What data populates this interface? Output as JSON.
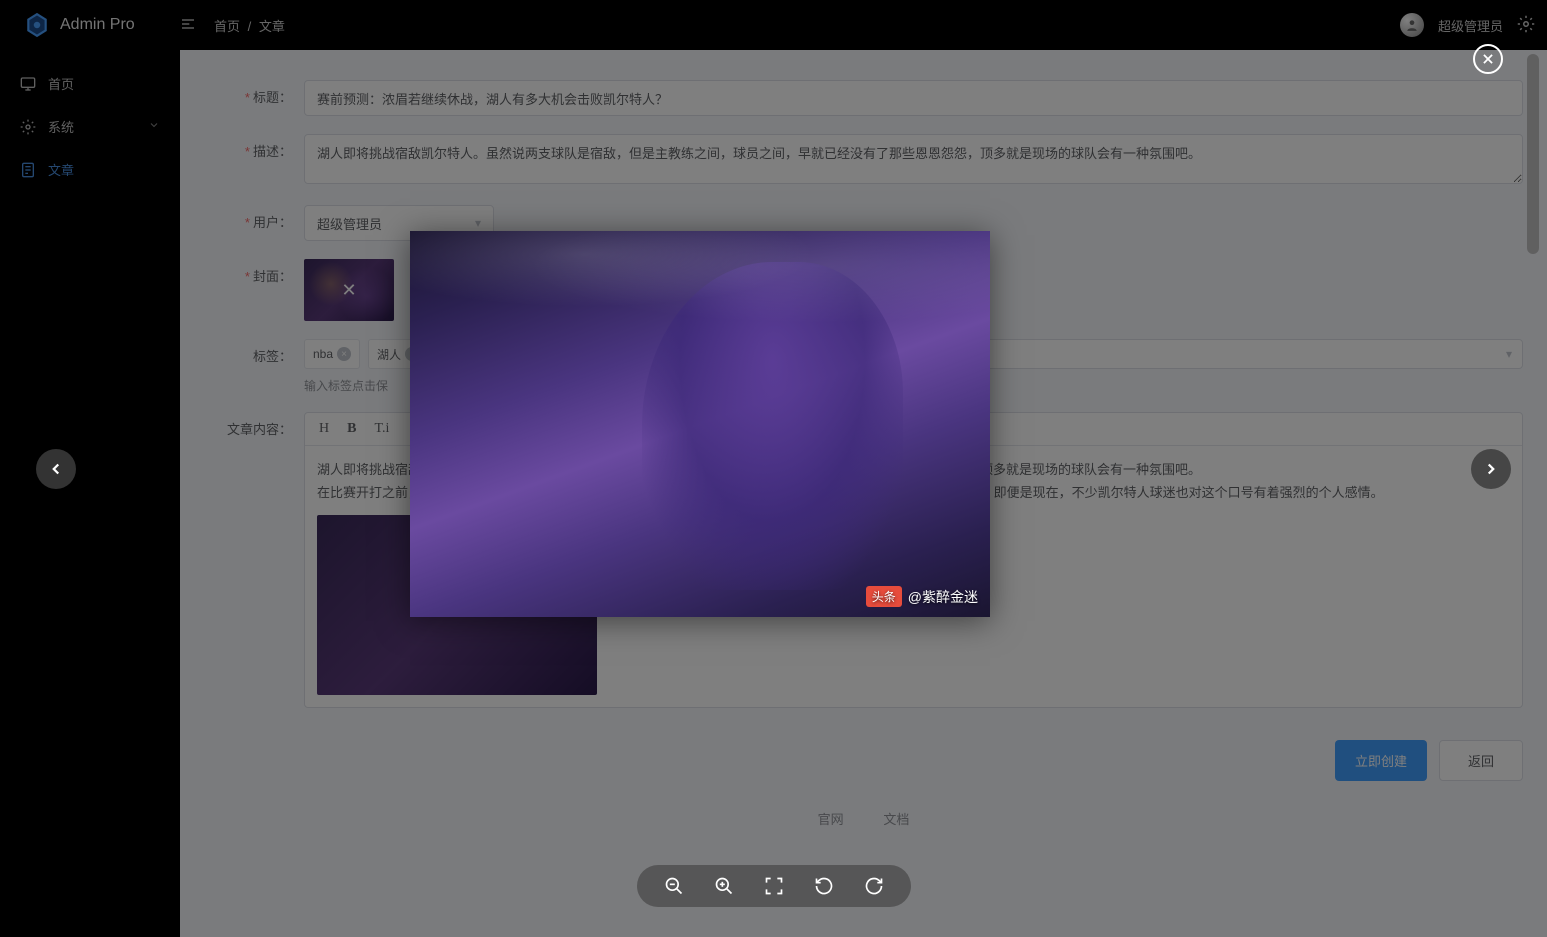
{
  "app": {
    "name": "Admin Pro"
  },
  "breadcrumb": {
    "home": "首页",
    "sep": "/",
    "current": "文章"
  },
  "user": {
    "name": "超级管理员"
  },
  "sidebar": {
    "items": [
      {
        "label": "首页",
        "icon": "monitor"
      },
      {
        "label": "系统",
        "icon": "gear",
        "expandable": true
      },
      {
        "label": "文章",
        "icon": "doc",
        "active": true
      }
    ]
  },
  "form": {
    "title": {
      "label": "标题：",
      "value": "赛前预测：浓眉若继续休战，湖人有多大机会击败凯尔特人？"
    },
    "desc": {
      "label": "描述：",
      "value": "湖人即将挑战宿敌凯尔特人。虽然说两支球队是宿敌，但是主教练之间，球员之间，早就已经没有了那些恩恩怨怨，顶多就是现场的球队会有一种氛围吧。"
    },
    "user": {
      "label": "用户：",
      "value": "超级管理员"
    },
    "cover": {
      "label": "封面："
    },
    "tags": {
      "label": "标签：",
      "chips": [
        "nba",
        "湖人"
      ],
      "hint": "输入标签点击保"
    },
    "content": {
      "label": "文章内容：",
      "tools": [
        "H",
        "B",
        "T.i"
      ],
      "para1": "湖人即将挑战宿敌凯尔特人。虽然说两支球队是宿敌，但是主教练之间，球员之间，早就已经没有了那些恩恩怨怨，顶多就是现场的球队会有一种氛围吧。",
      "para2": "在比赛开打之前，凯尔特人那边倒是有一些声音喊出了'Beat LA'，这是80年代湖凯争霸时，凯尔特人的主场惯用口号。即便是现在，不少凯尔特人球迷也对这个口号有着强烈的个人感情。"
    },
    "actions": {
      "submit": "立即创建",
      "cancel": "返回"
    }
  },
  "footer": {
    "link1": "官网",
    "link2": "文档"
  },
  "lightbox": {
    "watermark_badge": "头条",
    "watermark_text": "@紫醉金迷"
  }
}
